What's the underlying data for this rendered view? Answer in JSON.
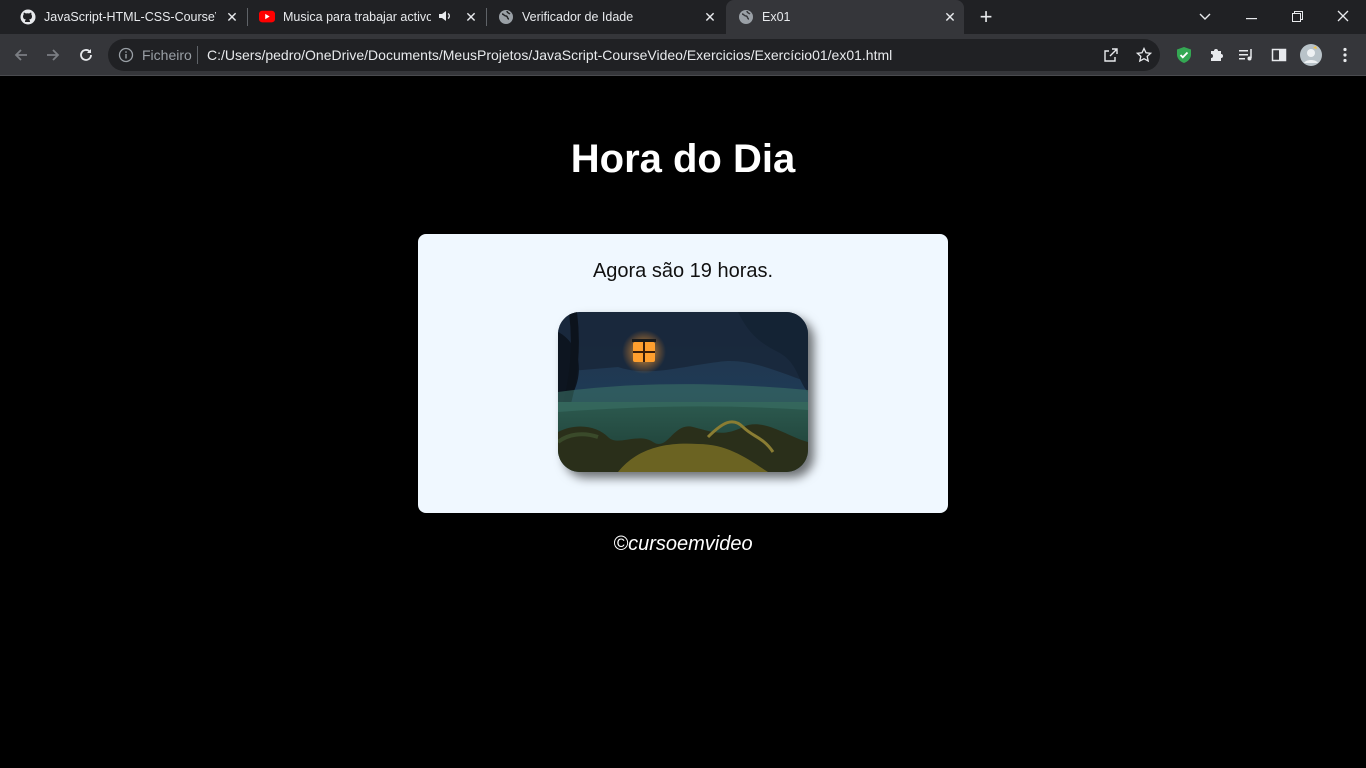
{
  "browser": {
    "tabs": [
      {
        "title": "JavaScript-HTML-CSS-CourseVid",
        "favicon": "github-icon"
      },
      {
        "title": "Musica para trabajar activo y",
        "favicon": "youtube-icon",
        "audio": "speaker-icon"
      },
      {
        "title": "Verificador de Idade",
        "favicon": "globe-icon"
      },
      {
        "title": "Ex01",
        "favicon": "globe-icon",
        "active": true
      }
    ],
    "address_bar": {
      "scheme_label": "Ficheiro",
      "url": "C:/Users/pedro/OneDrive/Documents/MeusProjetos/JavaScript-CourseVideo/Exercicios/Exercício01/ex01.html"
    }
  },
  "page": {
    "title": "Hora do Dia",
    "message": "Agora são 19 horas.",
    "image_alt": "evening forest with lantern",
    "footer": "©cursoemvideo",
    "colors": {
      "page_bg": "#000000",
      "card_bg": "#f0f8ff",
      "text_light": "#ffffff",
      "text_dark": "#111111"
    }
  }
}
